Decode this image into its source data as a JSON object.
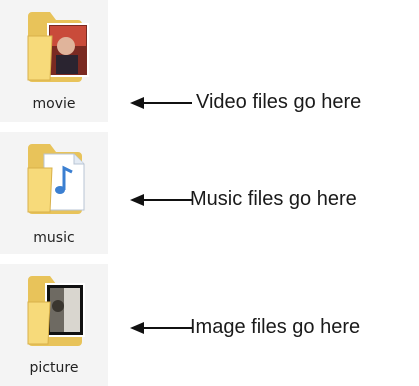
{
  "folders": [
    {
      "label": "movie",
      "thumbnail": "video-thumbnail",
      "caption": "Video files go here"
    },
    {
      "label": "music",
      "thumbnail": "mp3-document",
      "caption": "Music files go here"
    },
    {
      "label": "picture",
      "thumbnail": "photo-thumbnail",
      "caption": "Image files go here"
    }
  ],
  "colors": {
    "folder_back": "#e8c35a",
    "folder_front": "#f7da7a",
    "tile_background": "#f4f4f4",
    "arrow": "#111111"
  },
  "icons": [
    "folder-icon",
    "left-arrow-icon"
  ]
}
